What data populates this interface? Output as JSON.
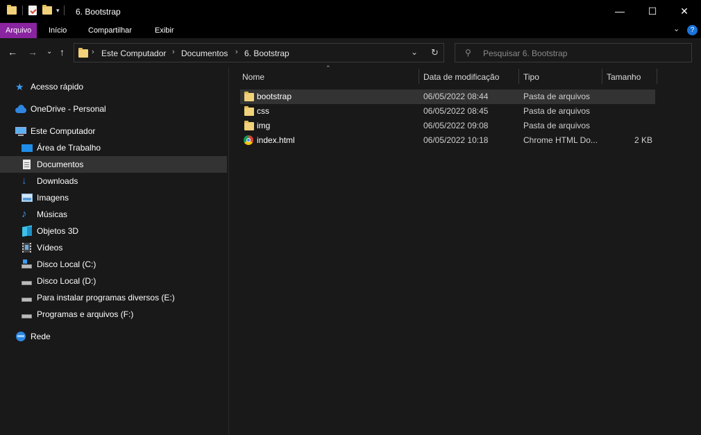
{
  "window": {
    "title": "6. Bootstrap",
    "minimize_glyph": "—",
    "maximize_glyph": "☐",
    "close_glyph": "✕"
  },
  "ribbon": {
    "tabs": [
      "Arquivo",
      "Início",
      "Compartilhar",
      "Exibir"
    ],
    "accent": "#8a24a0"
  },
  "address": {
    "crumbs": [
      "Este Computador",
      "Documentos",
      "6. Bootstrap"
    ],
    "search_placeholder": "Pesquisar 6. Bootstrap"
  },
  "sidebar": {
    "items": [
      {
        "label": "Acesso rápido",
        "icon": "star-icon"
      },
      {
        "label": "OneDrive - Personal",
        "icon": "cloud-icon"
      },
      {
        "label": "Este Computador",
        "icon": "computer-icon"
      },
      {
        "label": "Área de Trabalho",
        "icon": "desktop-icon"
      },
      {
        "label": "Documentos",
        "icon": "document-icon",
        "selected": true
      },
      {
        "label": "Downloads",
        "icon": "download-icon"
      },
      {
        "label": "Imagens",
        "icon": "image-icon"
      },
      {
        "label": "Músicas",
        "icon": "music-icon"
      },
      {
        "label": "Objetos 3D",
        "icon": "cube-icon"
      },
      {
        "label": "Vídeos",
        "icon": "video-icon"
      },
      {
        "label": "Disco Local (C:)",
        "icon": "drive-icon"
      },
      {
        "label": "Disco Local (D:)",
        "icon": "drive-icon"
      },
      {
        "label": "Para instalar programas diversos (E:)",
        "icon": "drive-icon"
      },
      {
        "label": "Programas e arquivos (F:)",
        "icon": "drive-icon"
      },
      {
        "label": "Rede",
        "icon": "network-icon"
      }
    ]
  },
  "columns": [
    "Nome",
    "Data de modificação",
    "Tipo",
    "Tamanho"
  ],
  "files": [
    {
      "name": "bootstrap",
      "modified": "06/05/2022 08:44",
      "type": "Pasta de arquivos",
      "size": "",
      "icon": "folder-icon",
      "selected": true
    },
    {
      "name": "css",
      "modified": "06/05/2022 08:45",
      "type": "Pasta de arquivos",
      "size": "",
      "icon": "folder-icon"
    },
    {
      "name": "img",
      "modified": "06/05/2022 09:08",
      "type": "Pasta de arquivos",
      "size": "",
      "icon": "folder-icon"
    },
    {
      "name": "index.html",
      "modified": "06/05/2022 10:18",
      "type": "Chrome HTML Do...",
      "size": "2 KB",
      "icon": "chrome-icon"
    }
  ]
}
